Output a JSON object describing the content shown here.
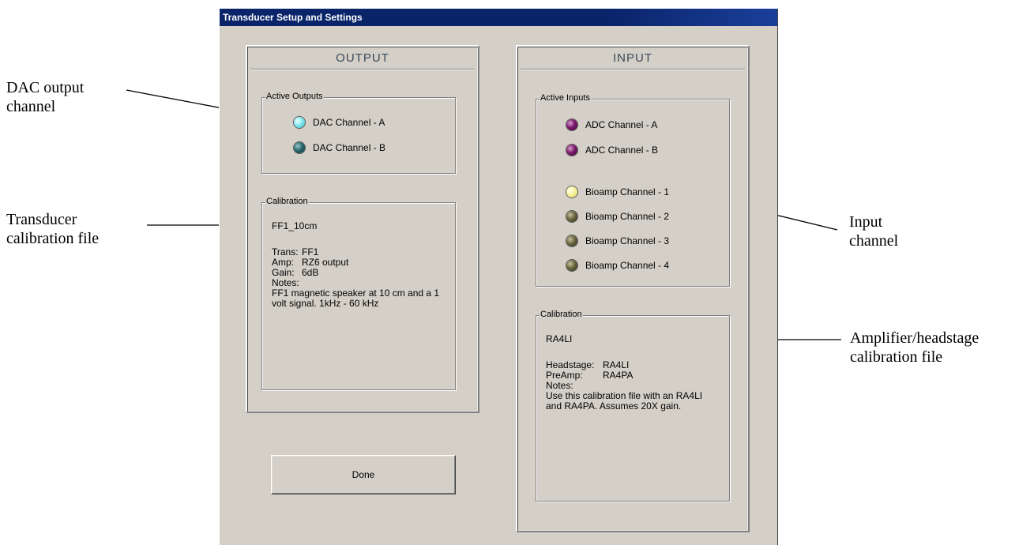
{
  "annotations": {
    "dac_line1": "DAC output",
    "dac_line2": "channel",
    "transducer_line1": "Transducer",
    "transducer_line2": "calibration file",
    "input_line1": "Input",
    "input_line2": "channel",
    "amp_line1": "Amplifier/headstage",
    "amp_line2": "calibration file"
  },
  "window": {
    "title": "Transducer Setup and Settings"
  },
  "output": {
    "title": "OUTPUT",
    "active_outputs_label": "Active Outputs",
    "channels": [
      {
        "label": "DAC Channel - A",
        "color": "#7fe6ee",
        "active": true
      },
      {
        "label": "DAC Channel - B",
        "color": "#1e5a5e",
        "active": false
      }
    ],
    "calibration": {
      "label": "Calibration",
      "file": "FF1_10cm",
      "trans_key": "Trans:",
      "trans_val": "FF1",
      "amp_key": "Amp:",
      "amp_val": "RZ6 output",
      "gain_key": "Gain:",
      "gain_val": "6dB",
      "notes_key": "Notes:",
      "notes_line1": "FF1 magnetic speaker at 10 cm and a 1",
      "notes_line2": "volt signal. 1kHz - 60 kHz"
    }
  },
  "input": {
    "title": "INPUT",
    "active_inputs_label": "Active Inputs",
    "adc_channels": [
      {
        "label": "ADC Channel - A",
        "color": "#6a1a5a"
      },
      {
        "label": "ADC Channel - B",
        "color": "#6a1a5a"
      }
    ],
    "bioamp_channels": [
      {
        "label": "Bioamp Channel - 1",
        "color": "#f6f090",
        "active": true
      },
      {
        "label": "Bioamp Channel - 2",
        "color": "#5e5a36"
      },
      {
        "label": "Bioamp Channel - 3",
        "color": "#5e5a36"
      },
      {
        "label": "Bioamp Channel - 4",
        "color": "#5e5a36"
      }
    ],
    "calibration": {
      "label": "Calibration",
      "file": "RA4LI",
      "headstage_key": "Headstage:",
      "headstage_val": "RA4LI",
      "preamp_key": "PreAmp:",
      "preamp_val": "RA4PA",
      "notes_key": "Notes:",
      "notes_line1": "Use this calibration file with an RA4LI",
      "notes_line2": "and RA4PA. Assumes 20X gain."
    }
  },
  "done_button": {
    "label": "Done"
  }
}
